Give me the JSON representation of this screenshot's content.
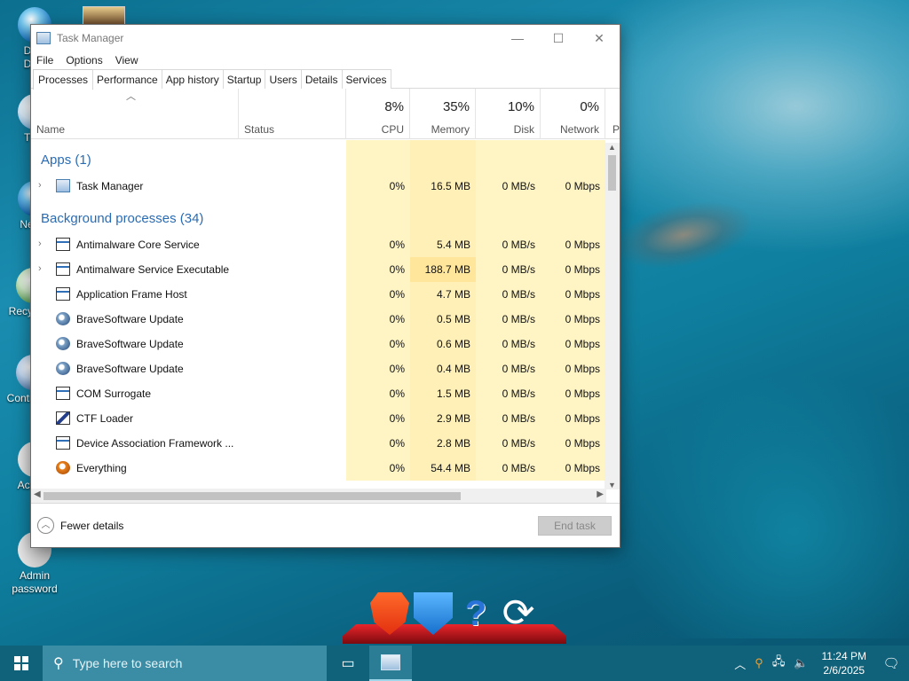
{
  "desktop": {
    "icons": [
      {
        "label": "Da\nDe"
      },
      {
        "label": "Th"
      },
      {
        "label": "Net"
      },
      {
        "label": "Recy"
      },
      {
        "label": "Contr"
      },
      {
        "label": "Act"
      },
      {
        "label": "Admin password"
      }
    ]
  },
  "window": {
    "title": "Task Manager",
    "controls": {
      "minimize": "—",
      "maximize": "☐",
      "close": "✕"
    }
  },
  "menu": [
    "File",
    "Options",
    "View"
  ],
  "tabs": [
    "Processes",
    "Performance",
    "App history",
    "Startup",
    "Users",
    "Details",
    "Services"
  ],
  "active_tab": "Processes",
  "columns": {
    "name": "Name",
    "status": "Status",
    "cpu": {
      "pct": "8%",
      "label": "CPU"
    },
    "memory": {
      "pct": "35%",
      "label": "Memory"
    },
    "disk": {
      "pct": "10%",
      "label": "Disk"
    },
    "network": {
      "pct": "0%",
      "label": "Network"
    },
    "extra": "P",
    "sort_indicator": "^"
  },
  "groups": {
    "apps": "Apps (1)",
    "background": "Background processes (34)"
  },
  "apps": [
    {
      "name": "Task Manager",
      "cpu": "0%",
      "memory": "16.5 MB",
      "disk": "0 MB/s",
      "network": "0 Mbps",
      "icon": "task-manager-icon",
      "expandable": true
    }
  ],
  "background": [
    {
      "name": "Antimalware Core Service",
      "cpu": "0%",
      "memory": "5.4 MB",
      "disk": "0 MB/s",
      "network": "0 Mbps",
      "icon": "window-icon",
      "expandable": true
    },
    {
      "name": "Antimalware Service Executable",
      "cpu": "0%",
      "memory": "188.7 MB",
      "disk": "0 MB/s",
      "network": "0 Mbps",
      "icon": "window-icon",
      "expandable": true
    },
    {
      "name": "Application Frame Host",
      "cpu": "0%",
      "memory": "4.7 MB",
      "disk": "0 MB/s",
      "network": "0 Mbps",
      "icon": "window-icon",
      "expandable": false
    },
    {
      "name": "BraveSoftware Update",
      "cpu": "0%",
      "memory": "0.5 MB",
      "disk": "0 MB/s",
      "network": "0 Mbps",
      "icon": "brave-update-icon",
      "expandable": false
    },
    {
      "name": "BraveSoftware Update",
      "cpu": "0%",
      "memory": "0.6 MB",
      "disk": "0 MB/s",
      "network": "0 Mbps",
      "icon": "brave-update-icon",
      "expandable": false
    },
    {
      "name": "BraveSoftware Update",
      "cpu": "0%",
      "memory": "0.4 MB",
      "disk": "0 MB/s",
      "network": "0 Mbps",
      "icon": "brave-update-icon",
      "expandable": false
    },
    {
      "name": "COM Surrogate",
      "cpu": "0%",
      "memory": "1.5 MB",
      "disk": "0 MB/s",
      "network": "0 Mbps",
      "icon": "window-icon",
      "expandable": false
    },
    {
      "name": "CTF Loader",
      "cpu": "0%",
      "memory": "2.9 MB",
      "disk": "0 MB/s",
      "network": "0 Mbps",
      "icon": "ctf-loader-icon",
      "expandable": false
    },
    {
      "name": "Device Association Framework ...",
      "cpu": "0%",
      "memory": "2.8 MB",
      "disk": "0 MB/s",
      "network": "0 Mbps",
      "icon": "window-icon",
      "expandable": false
    },
    {
      "name": "Everything",
      "cpu": "0%",
      "memory": "54.4 MB",
      "disk": "0 MB/s",
      "network": "0 Mbps",
      "icon": "everything-search-icon",
      "expandable": false
    }
  ],
  "footer": {
    "fewer_details": "Fewer details",
    "end_task": "End task"
  },
  "taskbar": {
    "search_placeholder": "Type here to search",
    "time": "11:24 PM",
    "date": "2/6/2025"
  }
}
